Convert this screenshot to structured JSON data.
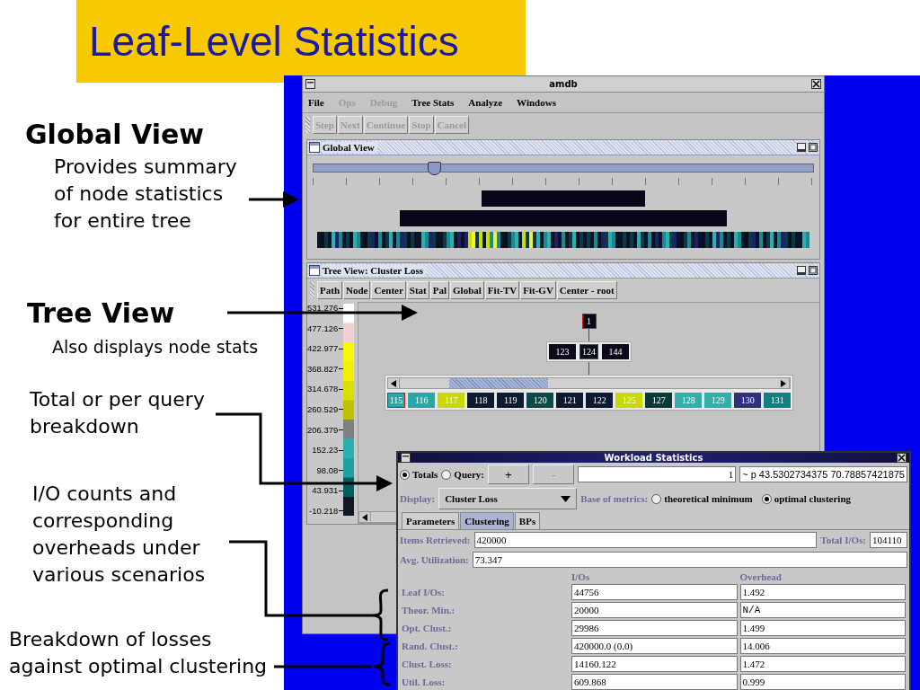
{
  "slide": {
    "title": "Leaf-Level Statistics",
    "annotations": [
      {
        "kind": "heading",
        "text": "Global View"
      },
      {
        "kind": "note",
        "text": "Provides summary of node statistics for entire tree"
      },
      {
        "kind": "heading",
        "text": "Tree View"
      },
      {
        "kind": "small",
        "text": "Also displays node stats"
      },
      {
        "kind": "note",
        "text": "Total or per query breakdown"
      },
      {
        "kind": "note",
        "text": "I/O counts and corresponding overheads under various scenarios"
      },
      {
        "kind": "note",
        "text": "Breakdown of losses against optimal clustering"
      }
    ]
  },
  "window": {
    "title": "amdb",
    "menu": [
      {
        "label": "File",
        "disabled": false
      },
      {
        "label": "Ops",
        "disabled": true
      },
      {
        "label": "Debug",
        "disabled": true
      },
      {
        "label": "Tree Stats",
        "disabled": false
      },
      {
        "label": "Analyze",
        "disabled": false
      },
      {
        "label": "Windows",
        "disabled": false
      }
    ],
    "toolbar": [
      {
        "label": "Step",
        "disabled": true
      },
      {
        "label": "Next",
        "disabled": true
      },
      {
        "label": "Continue",
        "disabled": true
      },
      {
        "label": "Stop",
        "disabled": true
      },
      {
        "label": "Cancel",
        "disabled": true
      }
    ],
    "global_view": {
      "title": "Global View",
      "slider": {
        "level": 0.24
      }
    },
    "tree_view": {
      "title": "Tree View: Cluster Loss",
      "toolbar": [
        "Path",
        "Node",
        "Center",
        "Stat",
        "Pal",
        "Global",
        "Fit-TV",
        "Fit-GV",
        "Center - root"
      ],
      "legend": [
        "531.276",
        "477.126",
        "422.977",
        "368.827",
        "314.678",
        "260.529",
        "206.379",
        "152.23",
        "98.08",
        "43.931",
        "-10.218"
      ],
      "root": {
        "label": "1",
        "color": "#0a0a14",
        "selected": true
      },
      "level2": [
        {
          "label": "123",
          "color": "#0a0a18",
          "selected": false
        },
        {
          "label": "124",
          "color": "#0a0a18",
          "selected": true
        },
        {
          "label": "144",
          "color": "#0a0a18",
          "selected": false
        }
      ],
      "leaves": [
        {
          "label": "115",
          "color": "#2aa8a8",
          "selected": true
        },
        {
          "label": "116",
          "color": "#2aa8a8",
          "selected": false
        },
        {
          "label": "117",
          "color": "#c8d800",
          "selected": false
        },
        {
          "label": "118",
          "color": "#0c1c30",
          "selected": false
        },
        {
          "label": "119",
          "color": "#0c1c30",
          "selected": false
        },
        {
          "label": "120",
          "color": "#0a4a48",
          "selected": false
        },
        {
          "label": "121",
          "color": "#0c1c30",
          "selected": false
        },
        {
          "label": "122",
          "color": "#0c1c30",
          "selected": false
        },
        {
          "label": "125",
          "color": "#c8d800",
          "selected": false
        },
        {
          "label": "127",
          "color": "#0a3a38",
          "selected": false
        },
        {
          "label": "128",
          "color": "#30b0a8",
          "selected": false
        },
        {
          "label": "129",
          "color": "#30b0a8",
          "selected": false
        },
        {
          "label": "130",
          "color": "#303080",
          "selected": false
        },
        {
          "label": "131",
          "color": "#108080",
          "selected": false
        }
      ]
    }
  },
  "dialog": {
    "title": "Workload Statistics",
    "modes": [
      {
        "label": "Totals",
        "selected": true
      },
      {
        "label": "Query:",
        "selected": false
      }
    ],
    "buttons": [
      {
        "label": "+",
        "disabled": false
      },
      {
        "label": "-",
        "disabled": true
      }
    ],
    "query_number": "1",
    "query_text": "~ p 43.5302734375 70.78857421875",
    "display_label": "Display:",
    "display_value": "Cluster Loss",
    "base_label": "Base of metrics:",
    "base_options": [
      {
        "label": "theoretical minimum",
        "selected": false
      },
      {
        "label": "optimal clustering",
        "selected": true
      }
    ],
    "tabs": [
      {
        "label": "Parameters",
        "selected": false
      },
      {
        "label": "Clustering",
        "selected": true
      },
      {
        "label": "BPs",
        "selected": false
      }
    ],
    "items_label": "Items Retrieved:",
    "items_value": "420000",
    "total_label": "Total I/Os:",
    "total_value": "104110",
    "util_label": "Avg. Utilization:",
    "util_value": "73.347",
    "columns": [
      "I/Os",
      "Overhead"
    ],
    "rows": [
      {
        "label": "Leaf I/Os:",
        "ios": "44756",
        "overhead": "1.492"
      },
      {
        "label": "Theor. Min.:",
        "ios": "20000",
        "overhead": "N/A"
      },
      {
        "label": "Opt. Clust.:",
        "ios": "29986",
        "overhead": "1.499"
      },
      {
        "label": "Rand. Clust.:",
        "ios": "420000.0 (0.0)",
        "overhead": "14.006"
      },
      {
        "label": "Clust. Loss:",
        "ios": "14160.122",
        "overhead": "1.472"
      },
      {
        "label": "Util. Loss:",
        "ios": "609.868",
        "overhead": "0.999"
      }
    ]
  }
}
